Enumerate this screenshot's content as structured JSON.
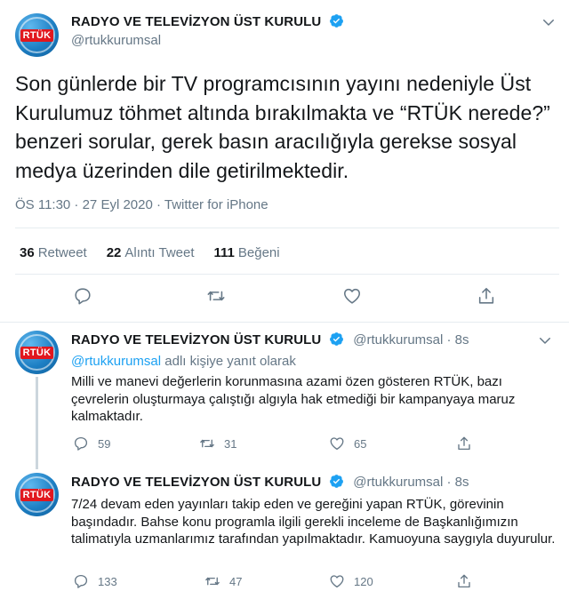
{
  "colors": {
    "verified": "#1da1f2",
    "text": "#14171a",
    "muted": "#657786",
    "link": "#1da1f2"
  },
  "main_tweet": {
    "avatar_text": "RTÜK",
    "name": "RADYO VE TELEVİZYON ÜST KURULU",
    "handle": "@rtukkurumsal",
    "text": "Son günlerde bir TV programcısının yayını nedeniyle Üst Kurulumuz töhmet altında bırakılmakta ve “RTÜK nerede?” benzeri sorular, gerek basın aracılığıyla gerekse sosyal medya üzerinden dile getirilmektedir.",
    "meta": "ÖS 11:30 · 27 Eyl 2020 · Twitter for iPhone",
    "stats": {
      "retweets_count": "36",
      "retweets_label": "Retweet",
      "quotes_count": "22",
      "quotes_label": "Alıntı Tweet",
      "likes_count": "111",
      "likes_label": "Beğeni"
    },
    "actions": [
      "reply-icon",
      "retweet-icon",
      "like-icon",
      "share-icon"
    ]
  },
  "replies": [
    {
      "avatar_text": "RTÜK",
      "name": "RADYO VE TELEVİZYON ÜST KURULU",
      "handle": "@rtukkurumsal · 8s",
      "replying_link": "@rtukkurumsal",
      "replying_suffix": " adlı kişiye yanıt olarak",
      "text": "Milli ve manevi değerlerin korunmasına azami özen gösteren RTÜK, bazı çevrelerin oluşturmaya çalıştığı algıyla hak etmediği bir kampanyaya maruz kalmaktadır.",
      "replies": "59",
      "retweets": "31",
      "likes": "65"
    },
    {
      "avatar_text": "RTÜK",
      "name": "RADYO VE TELEVİZYON ÜST KURULU",
      "handle": "@rtukkurumsal · 8s",
      "text": "7/24 devam eden yayınları takip eden ve gereğini yapan RTÜK, görevinin başındadır. Bahse konu programla ilgili gerekli inceleme de Başkanlığımızın talimatıyla uzmanlarımız tarafından yapılmaktadır.  Kamuoyuna saygıyla duyurulur.",
      "replies": "133",
      "retweets": "47",
      "likes": "120"
    }
  ]
}
